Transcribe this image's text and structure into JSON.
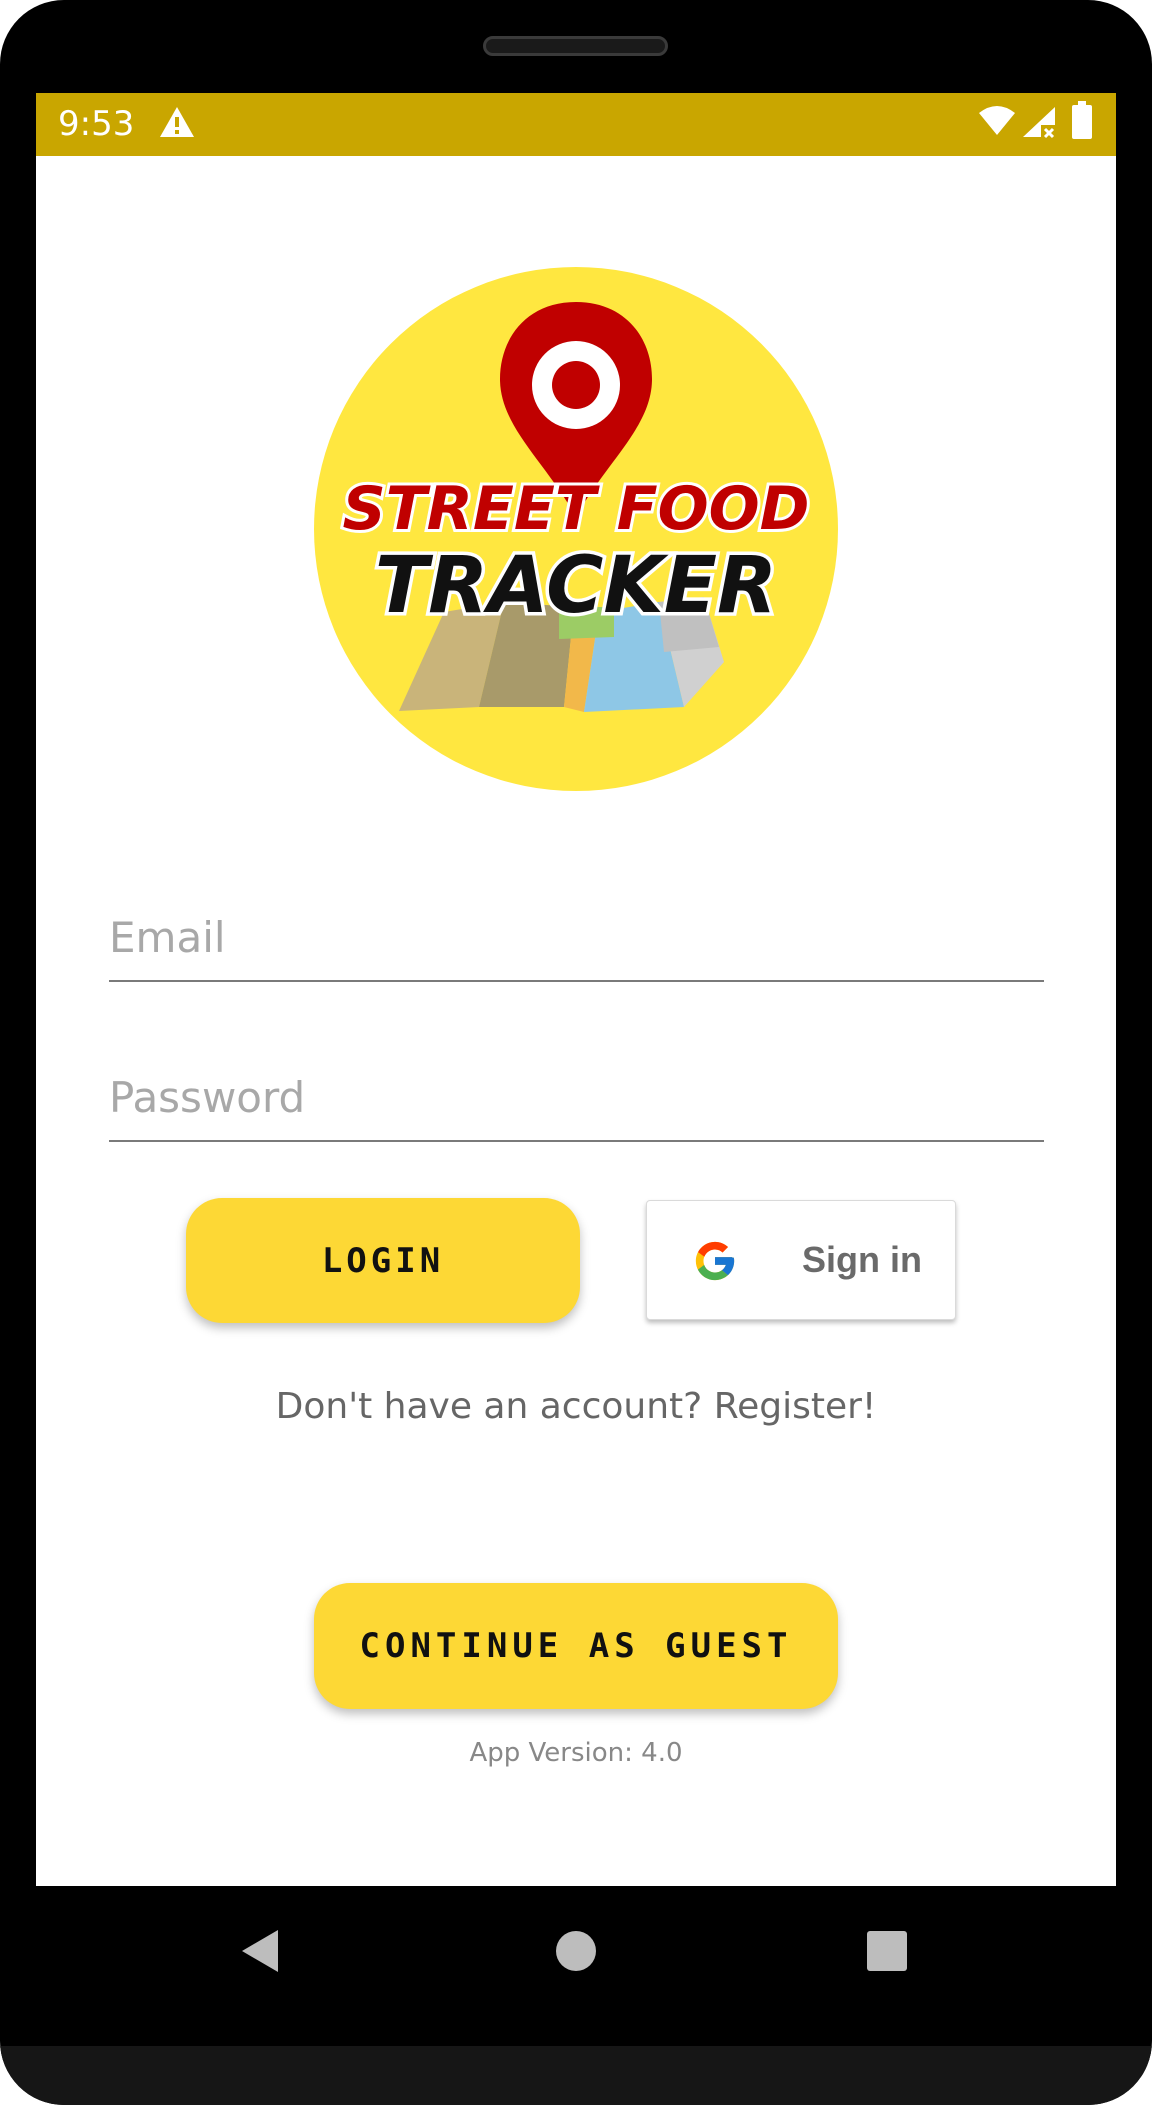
{
  "status_bar": {
    "time": "9:53",
    "icons": [
      "warning-icon",
      "wifi-icon",
      "signal-icon",
      "battery-icon"
    ]
  },
  "logo": {
    "line1": "STREET FOOD",
    "line2": "TRACKER"
  },
  "form": {
    "email_placeholder": "Email",
    "password_placeholder": "Password",
    "email_value": "",
    "password_value": ""
  },
  "buttons": {
    "login_label": "LOGIN",
    "google_label": "Sign in",
    "register_text": "Don't have an account? Register!",
    "guest_label": "CONTINUE AS GUEST"
  },
  "footer": {
    "app_version": "App Version: 4.0"
  },
  "colors": {
    "status_bar": "#c9a600",
    "accent_yellow": "#fdd835",
    "logo_circle": "#ffe740",
    "pin_red": "#c00000"
  },
  "nav": {
    "icons": [
      "back-icon",
      "home-icon",
      "recents-icon"
    ]
  }
}
